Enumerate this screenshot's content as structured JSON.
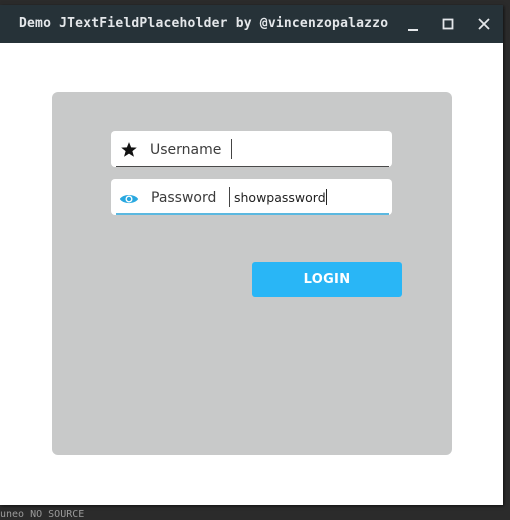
{
  "window": {
    "title": "Demo JTextFieldPlaceholder by @vincenzopalazzo",
    "icons": {
      "minimize": "minimize-icon",
      "maximize": "maximize-icon",
      "close": "close-icon"
    }
  },
  "form": {
    "username": {
      "label": "Username",
      "value": "",
      "icon": "star-icon"
    },
    "password": {
      "label": "Password",
      "value": "showpassword",
      "icon": "eye-icon"
    },
    "login_label": "LOGIN"
  },
  "background_text": "uneo NO SOURCE",
  "colors": {
    "titlebar": "#263238",
    "panel": "#c8c9c9",
    "accent": "#29b6f6",
    "eye_icon": "#29a8e0"
  }
}
